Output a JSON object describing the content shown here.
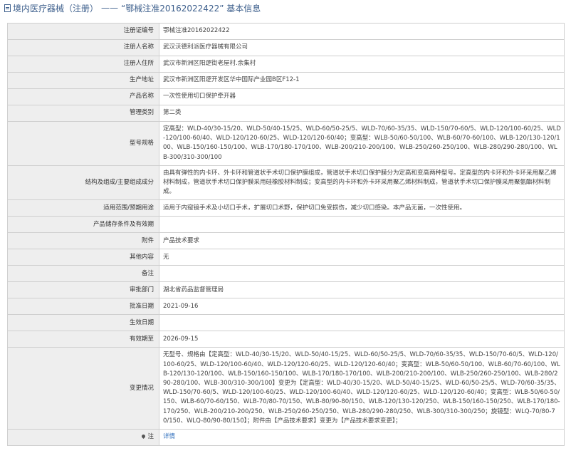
{
  "header": {
    "breadcrumb": "境内医疗器械（注册）",
    "separator": "——",
    "title": "“鄂械注准20162022422” 基本信息"
  },
  "rows": [
    {
      "label": "注册证编号",
      "value": "鄂械注准20162022422"
    },
    {
      "label": "注册人名称",
      "value": "武汉沃德利派医疗器械有限公司"
    },
    {
      "label": "注册人住所",
      "value": "武汉市新洲区阳逻街老屋村.余集村"
    },
    {
      "label": "生产地址",
      "value": "武汉市新洲区阳逻开发区华中国际产业园B区F12-1"
    },
    {
      "label": "产品名称",
      "value": "一次性使用切口保护牵开器"
    },
    {
      "label": "管理类别",
      "value": "第二类"
    },
    {
      "label": "型号规格",
      "value": "定高型：WLD-40/30-15/20、WLD-50/40-15/25、WLD-60/50-25/5、WLD-70/60-35/35、WLD-150/70-60/5、WLD-120/100-60/25、WLD-120/100-60/40、WLD-120/120-60/25、WLD-120/120-60/40；变高型：WLB-50/60-50/100、WLB-60/70-60/100、WLB-120/130-120/100、WLB-150/160-150/100、WLB-170/180-170/100、WLB-200/210-200/100、WLB-250/260-250/100、WLB-280/290-280/100、WLB-300/310-300/100"
    },
    {
      "label": "结构及组成/主要组成成分",
      "value": "由具有弹性的内卡环、外卡环和管道状手术切口保护膜组成，管道状手术切口保护膜分为定高和变高两种型号。定高型的内卡环和外卡环采用聚乙烯材料制成，管道状手术切口保护膜采用硅橡胶材料制成；变高型的内卡环和外卡环采用聚乙烯材料制成，管道状手术切口保护膜采用聚氨酯材料制成。"
    },
    {
      "label": "适用范围/预期用途",
      "value": "适用于内窥镜手术及小切口手术，扩展切口术野，保护切口免受损伤，减少切口感染。本产品无菌，一次性使用。"
    },
    {
      "label": "产品储存条件及有效期",
      "value": ""
    },
    {
      "label": "附件",
      "value": "产品技术要求"
    },
    {
      "label": "其他内容",
      "value": "无"
    },
    {
      "label": "备注",
      "value": ""
    },
    {
      "label": "审批部门",
      "value": "湖北省药品监督管理局"
    },
    {
      "label": "批准日期",
      "value": "2021-09-16"
    },
    {
      "label": "生效日期",
      "value": ""
    },
    {
      "label": "有效期至",
      "value": "2026-09-15"
    },
    {
      "label": "变更情况",
      "value": "无型号、规格由【定高型：WLD-40/30-15/20、WLD-50/40-15/25、WLD-60/50-25/5、WLD-70/60-35/35、WLD-150/70-60/5、WLD-120/100-60/25、WLD-120/100-60/40、WLD-120/120-60/25、WLD-120/120-60/40；变高型：WLB-50/60-50/100、WLB-60/70-60/100、WLB-120/130-120/100、WLB-150/160-150/100、WLB-170/180-170/100、WLB-200/210-200/100、WLB-250/260-250/100、WLB-280/290-280/100、WLB-300/310-300/100】变更为【定高型：WLD-40/30-15/20、WLD-50/40-15/25、WLD-60/50-25/5、WLD-70/60-35/35、WLD-150/70-60/5、WLD-120/100-60/25、WLD-120/100-60/40、WLD-120/120-60/25、WLD-120/120-60/40；变高型：WLB-50/60-50/150、WLB-60/70-60/150、WLB-70/80-70/150、WLB-80/90-80/150、WLB-120/130-120/250、WLB-150/160-150/250、WLB-170/180-170/250、WLB-200/210-200/250、WLB-250/260-250/250、WLB-280/290-280/250、WLB-300/310-300/250；旋镜型：WLQ-70/80-70/150、WLQ-80/90-80/150】；附件由【产品技术要求】变更为【产品技术要求变更】；"
    }
  ],
  "footer_row": {
    "label": "注",
    "value": "详情"
  }
}
